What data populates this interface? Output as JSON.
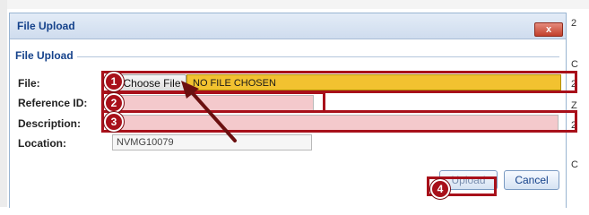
{
  "dialog": {
    "title": "File Upload",
    "close_label": "x",
    "section_legend": "File Upload"
  },
  "form": {
    "file_label": "File:",
    "choose_file_label": "Choose File",
    "file_status": "NO FILE CHOSEN",
    "reference_label": "Reference ID:",
    "reference_value": "",
    "description_label": "Description:",
    "description_value": "",
    "location_label": "Location:",
    "location_value": "NVMG10079"
  },
  "buttons": {
    "upload_label": "Upload",
    "cancel_label": "Cancel"
  },
  "annotations": {
    "step1": "1",
    "step2": "2",
    "step3": "3",
    "step4": "4",
    "highlight_color": "#a8101a"
  },
  "background": {
    "right_edge_chars": [
      "2",
      "C",
      "2",
      "Z",
      "2",
      "C"
    ]
  },
  "colors": {
    "title_text": "#15428b",
    "file_status_bg": "#f2c230",
    "input_highlight_bg": "#f4c9cc"
  }
}
